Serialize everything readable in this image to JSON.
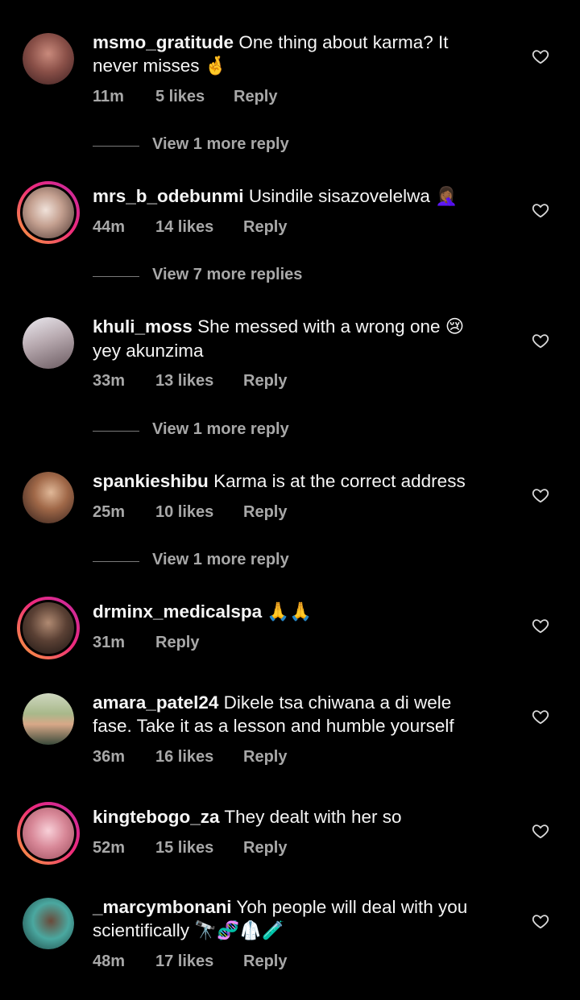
{
  "comments": [
    {
      "username": "msmo_gratitude",
      "text": "One thing about karma? It never misses",
      "emoji": "🤞",
      "time": "11m",
      "likes": "5 likes",
      "reply": "Reply",
      "story": false,
      "avatar_colors": [
        "#c98a7c",
        "#3a1e20"
      ]
    },
    {
      "username": "mrs_b_odebunmi",
      "text": "Usindile sisazovelelwa",
      "emoji": "🤦🏾‍♀️",
      "time": "44m",
      "likes": "14 likes",
      "reply": "Reply",
      "story": true,
      "avatar_colors": [
        "#e8d4c8",
        "#4a3430"
      ]
    },
    {
      "username": "khuli_moss",
      "text": "She messed with a wrong one",
      "emoji": "😢",
      "text2": "yey akunzima",
      "time": "33m",
      "likes": "13 likes",
      "reply": "Reply",
      "story": false,
      "avatar_colors": [
        "#d8d8e0",
        "#6a5a60"
      ]
    },
    {
      "username": "spankieshibu",
      "text": "Karma is at the correct address",
      "emoji": "",
      "time": "25m",
      "likes": "10 likes",
      "reply": "Reply",
      "story": false,
      "avatar_colors": [
        "#c79a7a",
        "#2a1a18"
      ]
    },
    {
      "username": "drminx_medicalspa",
      "text": "",
      "emoji": "🙏🙏",
      "time": "31m",
      "likes": "",
      "reply": "Reply",
      "story": true,
      "avatar_colors": [
        "#8a6a58",
        "#1a1412"
      ]
    },
    {
      "username": "amara_patel24",
      "text": "Dikele tsa chiwana a di wele fase. Take it as a lesson and humble yourself",
      "emoji": "",
      "time": "36m",
      "likes": "16 likes",
      "reply": "Reply",
      "story": false,
      "avatar_colors": [
        "#a8b88a",
        "#3a4a3a"
      ]
    },
    {
      "username": "kingtebogo_za",
      "text": "They dealt with her so",
      "emoji": "",
      "time": "52m",
      "likes": "15 likes",
      "reply": "Reply",
      "story": true,
      "avatar_colors": [
        "#f2b8c8",
        "#9a4a5a"
      ]
    },
    {
      "username": "_marcymbonani",
      "text": "Yoh people will deal with you scientifically",
      "emoji": "🔭🧬🥼🧪",
      "time": "48m",
      "likes": "17 likes",
      "reply": "Reply",
      "story": false,
      "avatar_colors": [
        "#4aa8a0",
        "#1a3a38"
      ]
    }
  ],
  "view_replies": [
    {
      "label": "View 1 more reply"
    },
    {
      "label": "View 7 more replies"
    },
    {
      "label": "View 1 more reply"
    },
    {
      "label": "View 1 more reply"
    }
  ]
}
